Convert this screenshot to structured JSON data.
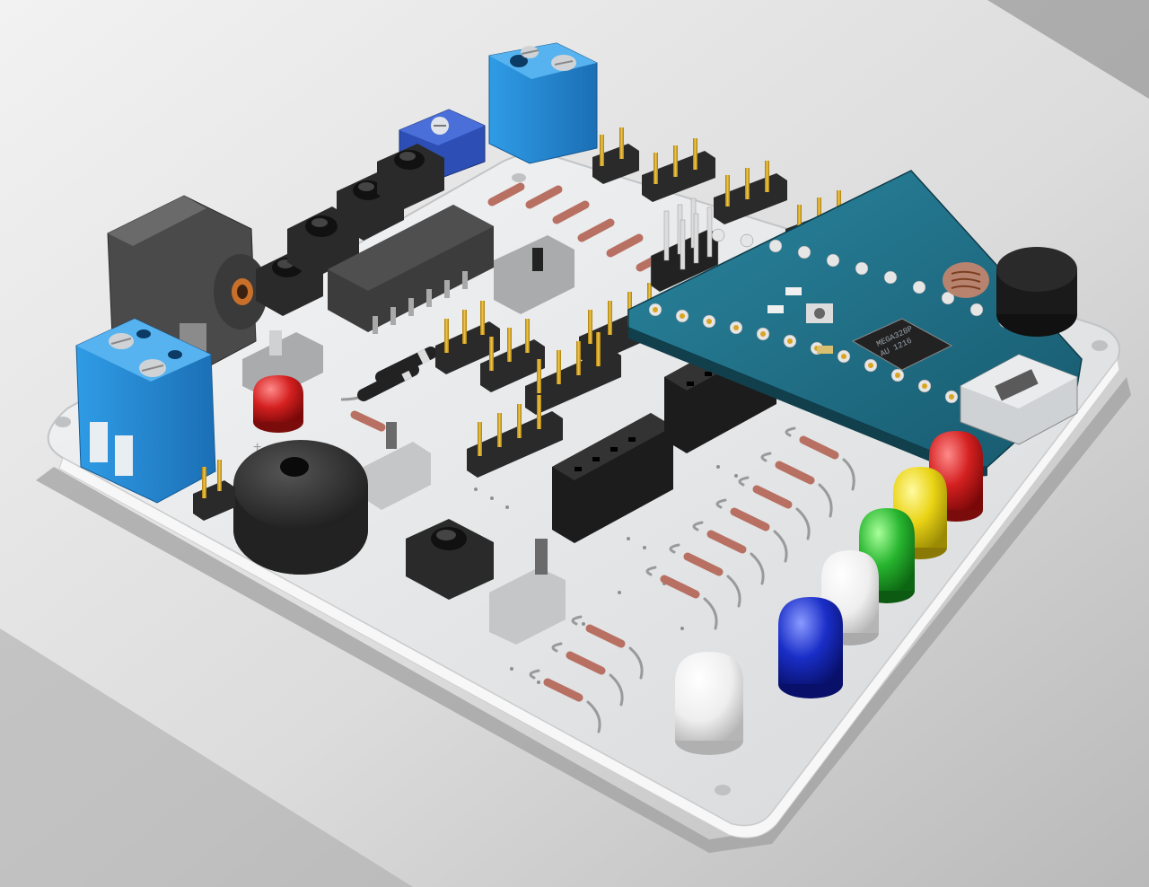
{
  "scene": {
    "board_name": "",
    "microcontroller_marking": "MEGA328P",
    "microcontroller_marking_line2": "AU 1216",
    "buzzer_polarity_mark": "+",
    "colors": {
      "background_light": "#efefef",
      "background_dark": "#9a9a9a",
      "board": "#e4e6e8",
      "nano_pcb": "#1f6e85",
      "terminal_block": "#2a8fd6",
      "led_red": "#c81e1e",
      "led_yellow": "#e8d21a",
      "led_green": "#23b02c",
      "led_white": "#f2f2f2",
      "led_blue": "#1a2ec8",
      "resistor": "#b87062",
      "header_black": "#1c1c1c",
      "pin_gold": "#d9a521"
    },
    "leds_right_row": [
      "led_blue",
      "led_white",
      "led_green",
      "led_yellow",
      "led_red"
    ],
    "icons": [
      "terminal-block-icon",
      "dc-jack-icon",
      "push-button-icon",
      "buzzer-icon",
      "potentiometer-icon",
      "ldr-icon",
      "usb-port-icon"
    ]
  }
}
